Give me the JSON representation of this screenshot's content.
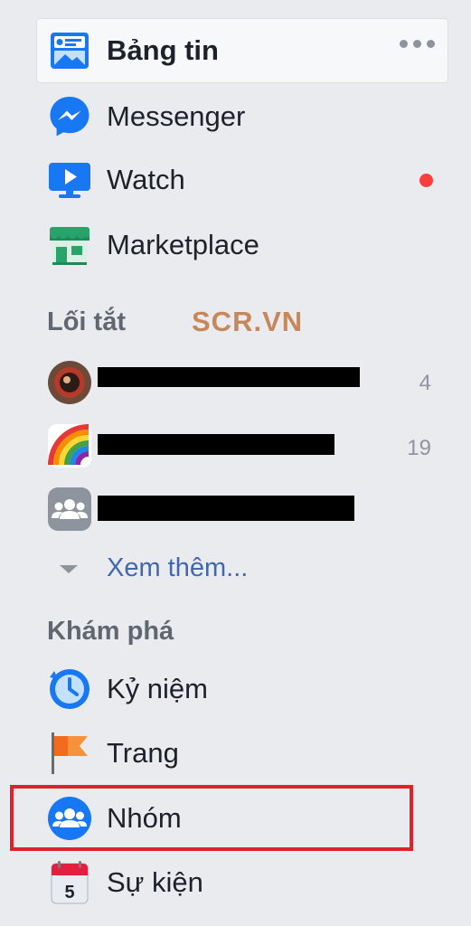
{
  "nav": {
    "news_feed": "Bảng tin",
    "messenger": "Messenger",
    "watch": "Watch",
    "marketplace": "Marketplace"
  },
  "shortcuts": {
    "title": "Lối tắt",
    "items": [
      {
        "label": "…",
        "count": "4",
        "icon": "profile-photo"
      },
      {
        "label": "…",
        "count": "19",
        "icon": "rainbow-icon"
      },
      {
        "label": "…",
        "count": "",
        "icon": "group-icon"
      }
    ],
    "see_more": "Xem thêm..."
  },
  "watermark": "SCR.VN",
  "explore": {
    "title": "Khám phá",
    "memories": "Kỷ niệm",
    "pages": "Trang",
    "groups": "Nhóm",
    "events": "Sự kiện",
    "events_day": "5"
  },
  "colors": {
    "accent": "#1877f2",
    "link": "#4267b2",
    "highlight": "#e0222b",
    "notification": "#fa3e3e"
  }
}
